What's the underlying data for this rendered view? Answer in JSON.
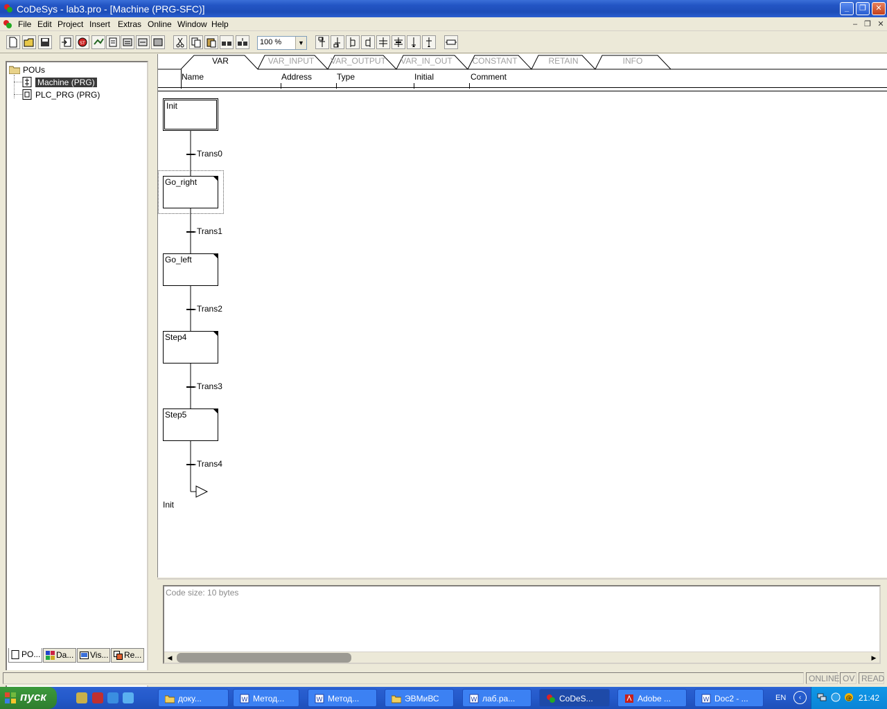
{
  "window": {
    "title": "CoDeSys - lab3.pro - [Machine (PRG-SFC)]"
  },
  "menu": [
    "File",
    "Edit",
    "Project",
    "Insert",
    "Extras",
    "Online",
    "Window",
    "Help"
  ],
  "toolbar": {
    "zoom": "100 %"
  },
  "tree": {
    "root": "POUs",
    "items": [
      "Machine (PRG)",
      "PLC_PRG (PRG)"
    ]
  },
  "left_tabs": [
    "PO...",
    "Da...",
    "Vis...",
    "Re..."
  ],
  "var_tabs": [
    "VAR",
    "VAR_INPUT",
    "VAR_OUTPUT",
    "VAR_IN_OUT",
    "CONSTANT",
    "RETAIN",
    "INFO"
  ],
  "var_columns": [
    "Name",
    "Address",
    "Type",
    "Initial",
    "Comment"
  ],
  "sfc": {
    "steps": [
      "Init",
      "Go_right",
      "Go_left",
      "Step4",
      "Step5"
    ],
    "transitions": [
      "Trans0",
      "Trans1",
      "Trans2",
      "Trans3",
      "Trans4"
    ],
    "jump_target": "Init"
  },
  "messages": {
    "text": "Code size: 10 bytes"
  },
  "status": [
    "ONLINE",
    "OV",
    "READ"
  ],
  "taskbar": {
    "start": "пуск",
    "tasks": [
      "доку...",
      "Метод...",
      "Метод...",
      "ЭВМиВС",
      "лаб.ра...",
      "CoDeS...",
      "Adobe ...",
      "Doc2 - ..."
    ],
    "lang": "EN",
    "clock": "21:42"
  },
  "colors": {
    "title_blue": "#2355c4",
    "taskbar_blue": "#245acb",
    "start_green": "#2e7d2e",
    "tray_blue": "#0b84d6"
  }
}
